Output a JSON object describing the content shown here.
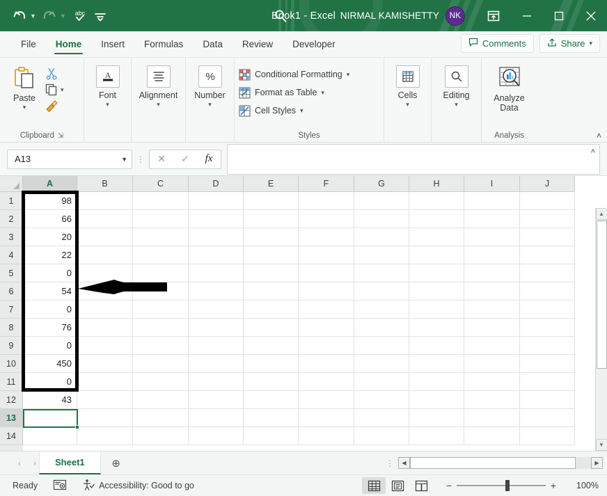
{
  "titlebar": {
    "document_title": "Book1 - Excel",
    "account_name": "NIRMAL KAMISHETTY",
    "avatar_initials": "NK",
    "qat": [
      {
        "name": "undo",
        "glyph": "↶"
      },
      {
        "name": "redo",
        "glyph": "↷"
      },
      {
        "name": "spelling",
        "glyph": "abc"
      },
      {
        "name": "customize-qat",
        "glyph": "≡"
      }
    ],
    "search_icon": "search-icon",
    "ribbon_display_icon": "ribbon-display-options-icon",
    "minimize": "—",
    "maximize": "□",
    "close": "✕"
  },
  "tabs": [
    {
      "label": "File",
      "active": false
    },
    {
      "label": "Home",
      "active": true
    },
    {
      "label": "Insert",
      "active": false
    },
    {
      "label": "Formulas",
      "active": false
    },
    {
      "label": "Data",
      "active": false
    },
    {
      "label": "Review",
      "active": false
    },
    {
      "label": "Developer",
      "active": false
    }
  ],
  "tabstrip_right": {
    "comments_label": "Comments",
    "share_label": "Share"
  },
  "ribbon": {
    "clipboard": {
      "group_label": "Clipboard",
      "paste_label": "Paste",
      "cut_name": "cut-icon",
      "copy_name": "copy-icon",
      "format_painter_name": "format-painter-icon",
      "dialog_launcher": "⤵"
    },
    "font": {
      "label": "Font",
      "icon": "font-icon"
    },
    "alignment": {
      "label": "Alignment",
      "icon": "alignment-icon"
    },
    "number": {
      "label": "Number",
      "icon": "percent-icon"
    },
    "styles": {
      "group_label": "Styles",
      "items": [
        {
          "label": "Conditional Formatting",
          "icon": "conditional-formatting-icon"
        },
        {
          "label": "Format as Table",
          "icon": "format-as-table-icon"
        },
        {
          "label": "Cell Styles",
          "icon": "cell-styles-icon"
        }
      ]
    },
    "cells": {
      "label": "Cells",
      "icon": "cells-icon"
    },
    "editing": {
      "label": "Editing",
      "icon": "editing-icon"
    },
    "analysis": {
      "group_label": "Analysis",
      "analyze_label_line1": "Analyze",
      "analyze_label_line2": "Data",
      "icon": "analyze-data-icon"
    },
    "collapse_ribbon": "˄"
  },
  "formula_bar": {
    "name_box_value": "A13",
    "cancel_icon": "✕",
    "enter_icon": "✓",
    "function_icon": "fx",
    "formula_value": "",
    "expand_icon": "˄"
  },
  "grid": {
    "columns": [
      "A",
      "B",
      "C",
      "D",
      "E",
      "F",
      "G",
      "H",
      "I",
      "J"
    ],
    "selected_column": "A",
    "rows": [
      {
        "num": "1",
        "values": [
          "98",
          "",
          "",
          "",
          "",
          "",
          "",
          "",
          "",
          ""
        ]
      },
      {
        "num": "2",
        "values": [
          "66",
          "",
          "",
          "",
          "",
          "",
          "",
          "",
          "",
          ""
        ]
      },
      {
        "num": "3",
        "values": [
          "20",
          "",
          "",
          "",
          "",
          "",
          "",
          "",
          "",
          ""
        ]
      },
      {
        "num": "4",
        "values": [
          "22",
          "",
          "",
          "",
          "",
          "",
          "",
          "",
          "",
          ""
        ]
      },
      {
        "num": "5",
        "values": [
          "0",
          "",
          "",
          "",
          "",
          "",
          "",
          "",
          "",
          ""
        ]
      },
      {
        "num": "6",
        "values": [
          "54",
          "",
          "",
          "",
          "",
          "",
          "",
          "",
          "",
          ""
        ]
      },
      {
        "num": "7",
        "values": [
          "0",
          "",
          "",
          "",
          "",
          "",
          "",
          "",
          "",
          ""
        ]
      },
      {
        "num": "8",
        "values": [
          "76",
          "",
          "",
          "",
          "",
          "",
          "",
          "",
          "",
          ""
        ]
      },
      {
        "num": "9",
        "values": [
          "0",
          "",
          "",
          "",
          "",
          "",
          "",
          "",
          "",
          ""
        ]
      },
      {
        "num": "10",
        "values": [
          "450",
          "",
          "",
          "",
          "",
          "",
          "",
          "",
          "",
          ""
        ]
      },
      {
        "num": "11",
        "values": [
          "0",
          "",
          "",
          "",
          "",
          "",
          "",
          "",
          "",
          ""
        ]
      },
      {
        "num": "12",
        "values": [
          "43",
          "",
          "",
          "",
          "",
          "",
          "",
          "",
          "",
          ""
        ]
      },
      {
        "num": "13",
        "values": [
          "",
          "",
          "",
          "",
          "",
          "",
          "",
          "",
          "",
          ""
        ]
      },
      {
        "num": "14",
        "values": [
          "",
          "",
          "",
          "",
          "",
          "",
          "",
          "",
          "",
          ""
        ]
      }
    ],
    "selected_cell": "A13",
    "annotations": {
      "highlight_box_name": "black-rectangle-annotation",
      "arrow_name": "black-arrow-annotation"
    }
  },
  "sheetbar": {
    "prev_icon": "‹",
    "next_icon": "›",
    "sheets": [
      {
        "label": "Sheet1",
        "active": true
      }
    ],
    "add_sheet_icon": "⊕"
  },
  "statusbar": {
    "mode": "Ready",
    "macro_icon": "record-macro-icon",
    "accessibility": "Accessibility: Good to go",
    "views": [
      {
        "name": "normal-view",
        "active": true
      },
      {
        "name": "page-layout-view",
        "active": false
      },
      {
        "name": "page-break-preview",
        "active": false
      }
    ],
    "zoom_out": "−",
    "zoom_in": "+",
    "zoom_level": "100%"
  },
  "colors": {
    "excel_green": "#217346",
    "accent_dark_green": "#1d6f42",
    "avatar_purple": "#5b2d8e",
    "annotation_black": "#000000"
  }
}
